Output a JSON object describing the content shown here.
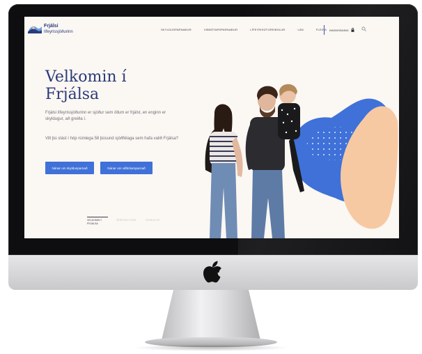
{
  "site": {
    "logo_title": "Frjálsi",
    "logo_subtitle": "lífeyrissjóðurinn"
  },
  "nav": {
    "items": [
      {
        "label": "SKYLDUSPARNAÐUR"
      },
      {
        "label": "VIÐBÓTARSPARNAÐUR"
      },
      {
        "label": "LÍFEYRISÚTGREIÐSLUR"
      },
      {
        "label": "LÁN"
      },
      {
        "label": "FLEIRA"
      }
    ],
    "login_label": "INNSKRÁNING"
  },
  "hero": {
    "title_line1": "Velkomin í",
    "title_line2": "Frjálsa",
    "paragraph1": "Frjálsi lífeyrissjóðurinn er sjóður sem öllum er frjálst, en enginn er skyldugur, að greiða í.",
    "paragraph2": "Vilt þú slást í hóp rúmlega 58 þúsund sjóðfélaga sem hafa valið Frjálsa?",
    "button1": "Nánar um skyldusparnað",
    "button2": "Nánar um viðbótarsparnað"
  },
  "slider": {
    "tabs": [
      {
        "label": "VELKOMIN Í FRJÁLSA",
        "active": true
      },
      {
        "label": "SÉREIGN Í STAÐ",
        "active": false
      },
      {
        "label": "FRJÁLSI LÍF",
        "active": false
      }
    ]
  },
  "colors": {
    "brand_navy": "#2a3a7a",
    "accent_blue": "#3f71d8",
    "peach": "#f7c9a2",
    "screen_bg": "#fbf7f2"
  }
}
